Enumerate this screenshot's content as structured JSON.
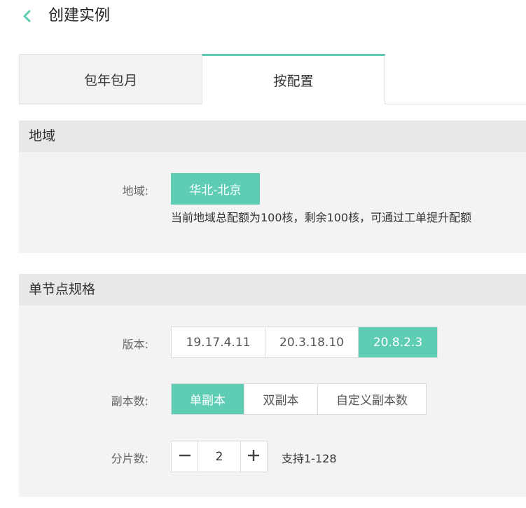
{
  "header": {
    "title": "创建实例",
    "back_icon": "chevron-left-icon"
  },
  "tabs": [
    {
      "label": "包年包月",
      "active": false
    },
    {
      "label": "按配置",
      "active": true
    }
  ],
  "region_section": {
    "title": "地域",
    "label": "地域:",
    "selected": "华北-北京",
    "hint": "当前地域总配额为100核，剩余100核，可通过工单提升配额"
  },
  "spec_section": {
    "title": "单节点规格",
    "version": {
      "label": "版本:",
      "options": [
        "19.17.4.11",
        "20.3.18.10",
        "20.8.2.3"
      ],
      "selected": "20.8.2.3"
    },
    "replicas": {
      "label": "副本数:",
      "options": [
        "单副本",
        "双副本",
        "自定义副本数"
      ],
      "selected": "单副本"
    },
    "shards": {
      "label": "分片数:",
      "value": "2",
      "hint": "支持1-128"
    }
  },
  "colors": {
    "accent": "#5fcdb4",
    "panel_bg": "#f3f3f3",
    "panel_header_bg": "#e8e8e8"
  }
}
